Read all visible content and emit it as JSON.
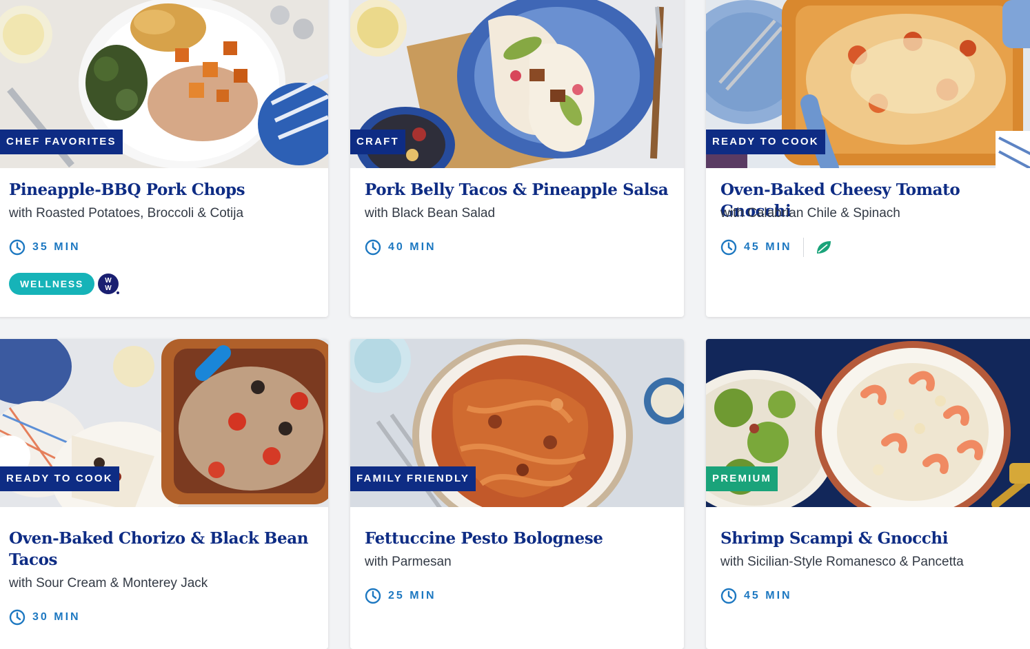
{
  "colors": {
    "badge_blue": "#0e2c84",
    "badge_green": "#1aa37a",
    "title_blue": "#0e2c84",
    "time_blue": "#1d78c1",
    "wellness_teal": "#16b3b8"
  },
  "recipes": [
    {
      "badge": "CHEF FAVORITES",
      "title": "Pineapple-BBQ Pork Chops",
      "subtitle": "with Roasted Potatoes, Broccoli & Cotija",
      "time": "35 MIN",
      "tags": {
        "wellness": "WELLNESS",
        "ww_logo": "ww-logo-icon"
      }
    },
    {
      "badge": "CRAFT",
      "title": "Pork Belly Tacos & Pineapple Salsa",
      "subtitle": "with Black Bean Salad",
      "time": "40 MIN"
    },
    {
      "badge": "READY TO COOK",
      "title": "Oven-Baked Cheesy Tomato Gnocchi",
      "subtitle": "with Calabrian Chile & Spinach",
      "time": "45 MIN",
      "extra_icon": "leaf-icon"
    },
    {
      "badge": "READY TO COOK",
      "title": "Oven-Baked Chorizo & Black Bean Tacos",
      "subtitle": "with Sour Cream & Monterey Jack",
      "time": "30 MIN"
    },
    {
      "badge": "FAMILY FRIENDLY",
      "title": "Fettuccine Pesto Bolognese",
      "subtitle": "with Parmesan",
      "time": "25 MIN"
    },
    {
      "badge": "PREMIUM",
      "title": "Shrimp Scampi & Gnocchi",
      "subtitle": "with Sicilian-Style Romanesco & Pancetta",
      "time": "45 MIN"
    }
  ]
}
